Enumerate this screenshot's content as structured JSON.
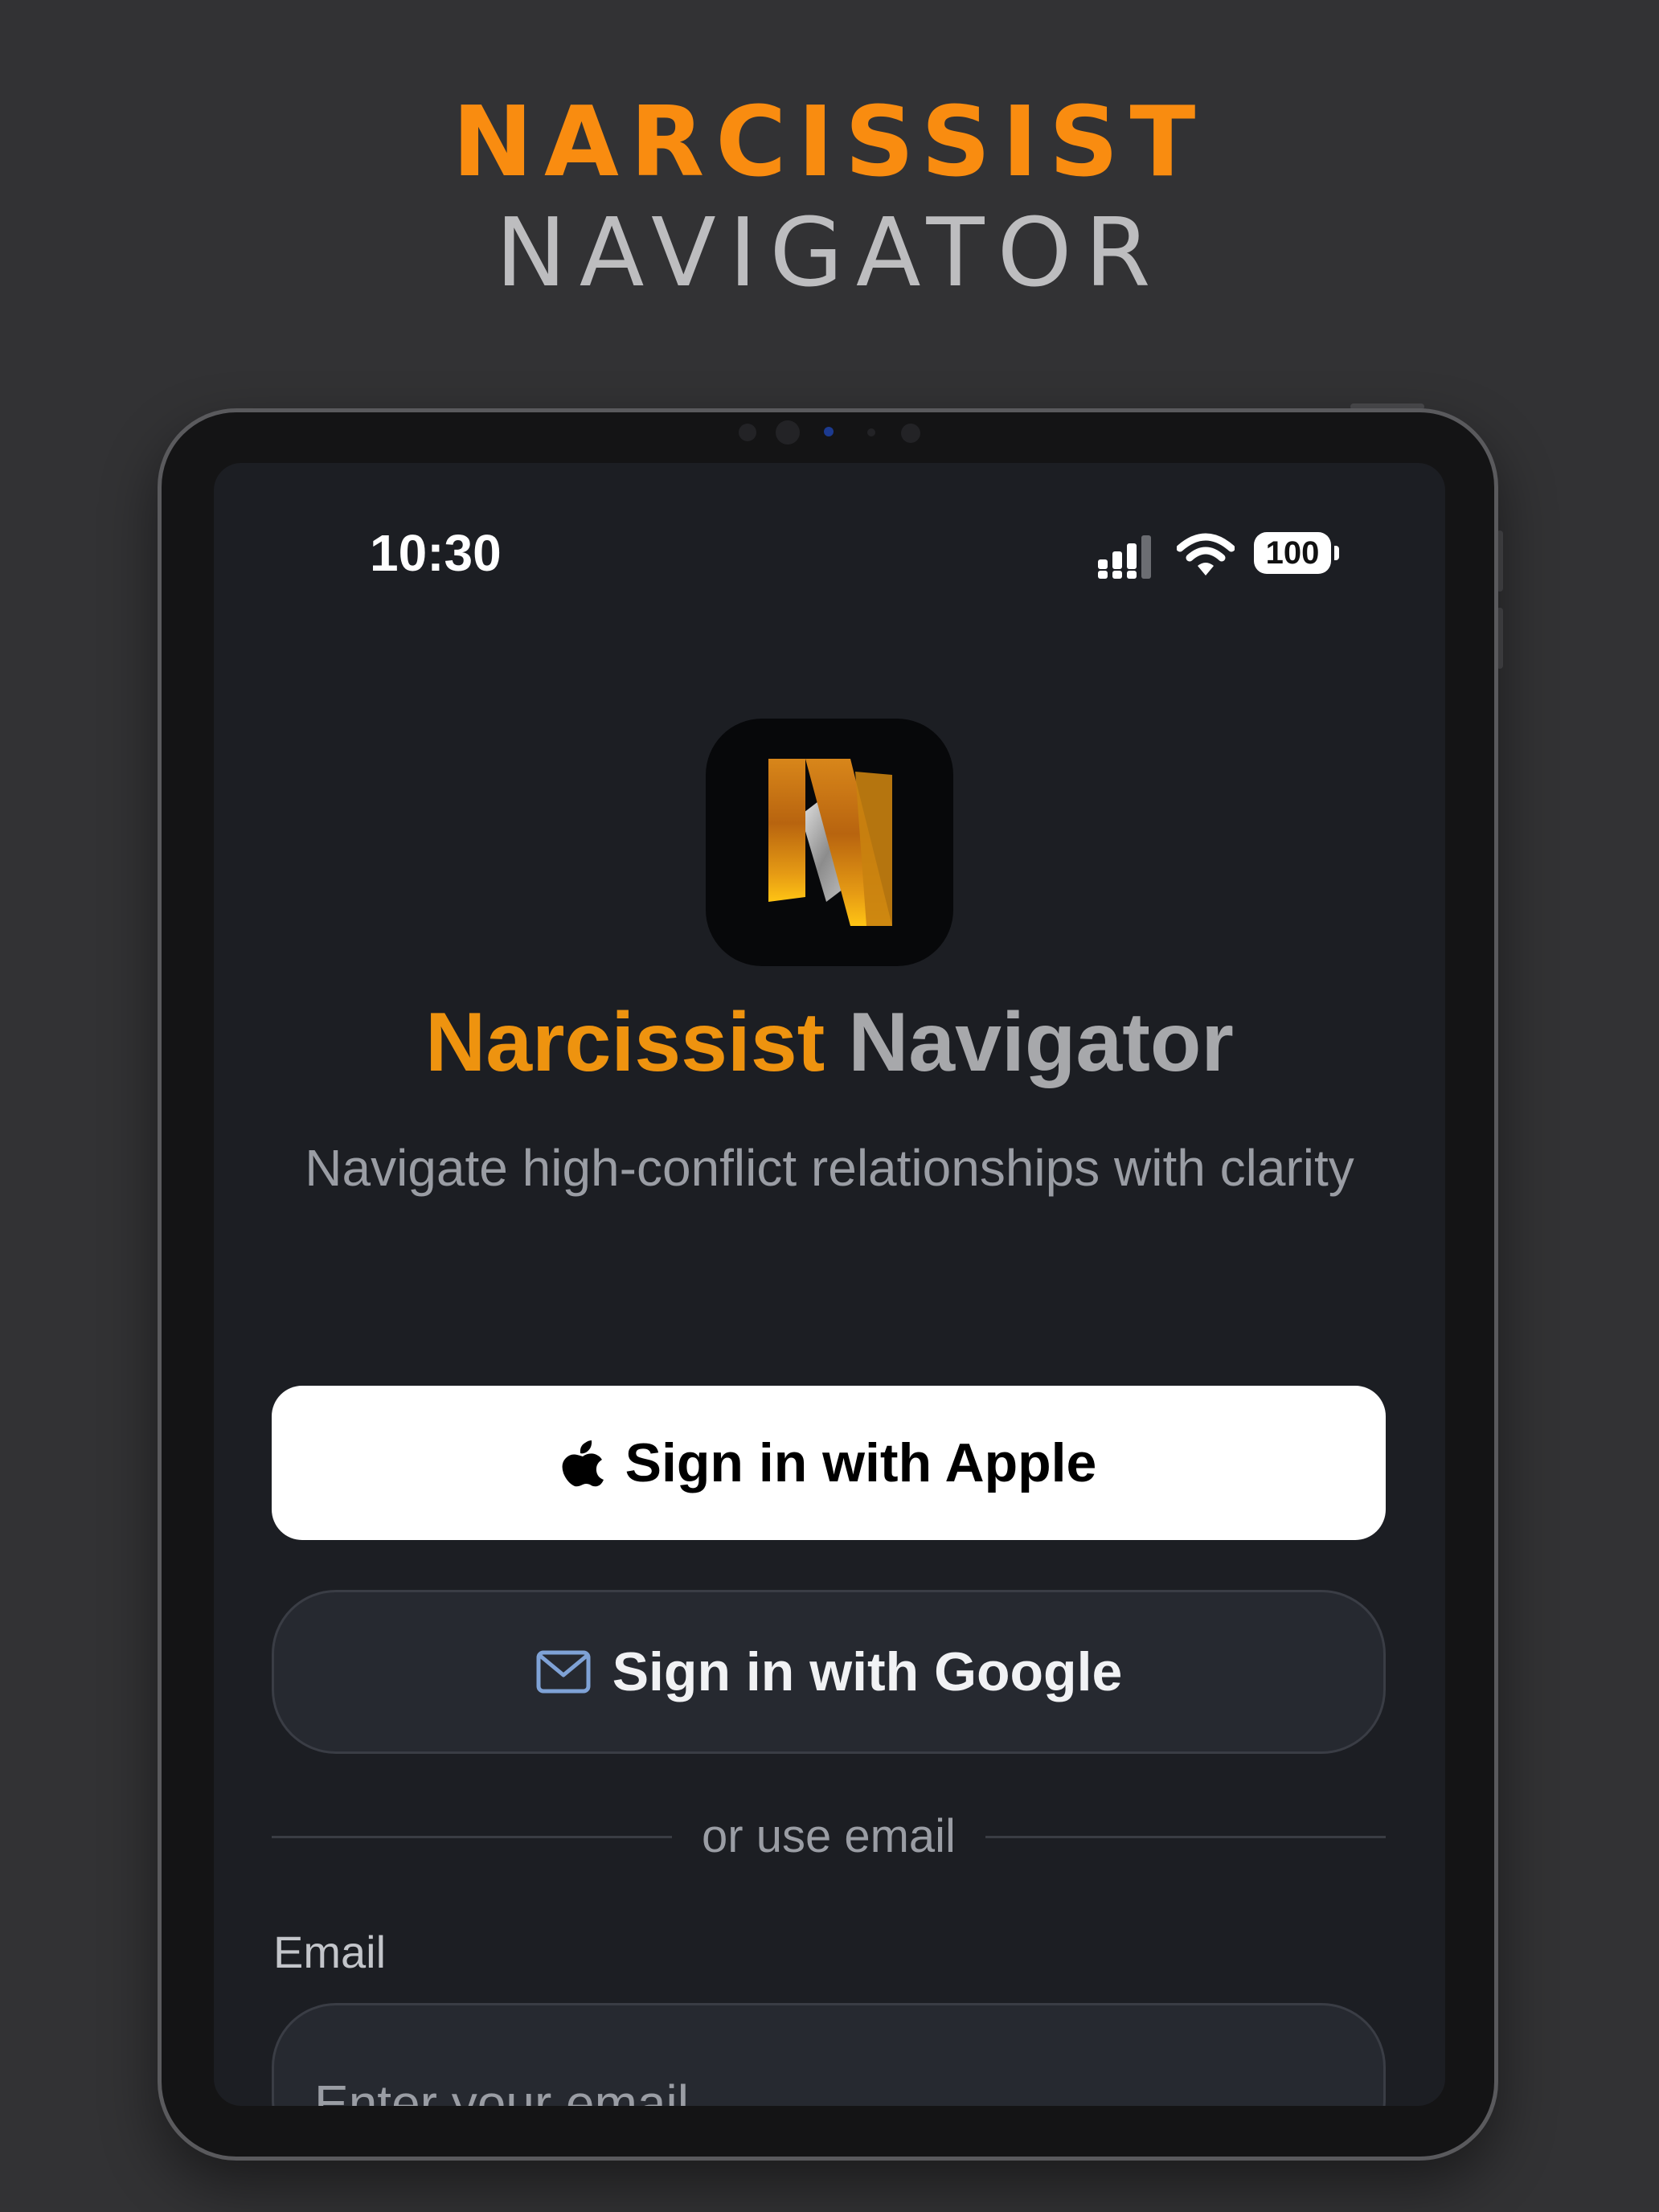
{
  "promo": {
    "line1": "NARCISSIST",
    "line2": "NAVIGATOR"
  },
  "status_bar": {
    "time": "10:30",
    "battery": "100",
    "icons": [
      "cellular-signal-icon",
      "wifi-icon",
      "battery-icon"
    ]
  },
  "app": {
    "icon_name": "app-logo-n-icon",
    "title_part1": "Narcissist",
    "title_part2": "Navigator",
    "subtitle": "Navigate high-conflict relationships with clarity"
  },
  "auth": {
    "apple_label": "Sign in with Apple",
    "apple_icon": "apple-logo-icon",
    "google_label": "Sign in with Google",
    "google_icon": "mail-envelope-icon",
    "divider_text": "or use email",
    "email_label": "Email",
    "email_placeholder": "Enter your email",
    "email_value": ""
  },
  "colors": {
    "background": "#323234",
    "accent_orange": "#F98C10",
    "screen_bg": "#1C1E23",
    "button_dark": "#262930"
  }
}
